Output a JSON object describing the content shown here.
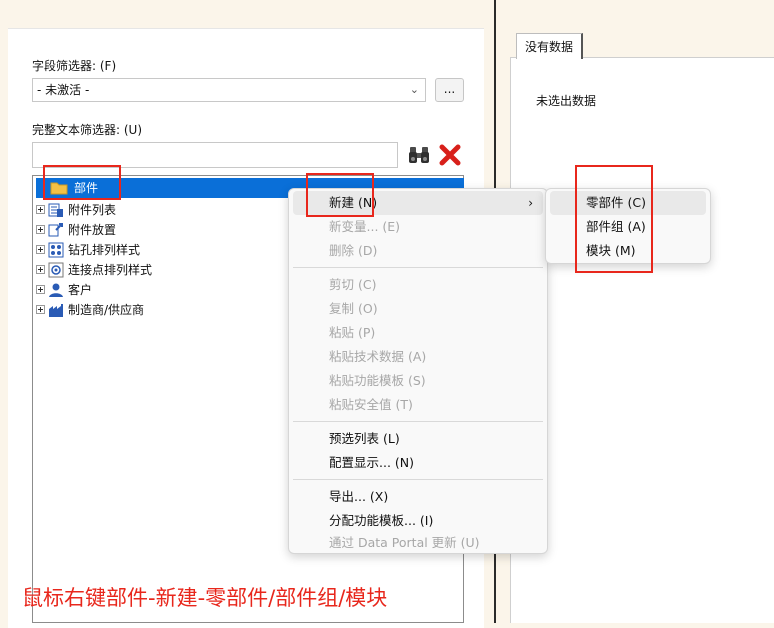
{
  "filters": {
    "field_filter_label": "字段筛选器: (F)",
    "field_filter_value": "- 未激活 -",
    "more_button": "...",
    "fulltext_label": "完整文本筛选器: (U)",
    "fulltext_value": ""
  },
  "tree": {
    "items": [
      {
        "label": "部件",
        "icon": "folder-icon"
      },
      {
        "label": "附件列表",
        "icon": "attachment-list-icon"
      },
      {
        "label": "附件放置",
        "icon": "attachment-placement-icon"
      },
      {
        "label": "钻孔排列样式",
        "icon": "drill-pattern-icon"
      },
      {
        "label": "连接点排列样式",
        "icon": "connection-point-icon"
      },
      {
        "label": "客户",
        "icon": "customer-icon"
      },
      {
        "label": "制造商/供应商",
        "icon": "manufacturer-icon"
      }
    ]
  },
  "context_menu": {
    "items": [
      {
        "label": "新建 (N)",
        "enabled": true,
        "submenu": true
      },
      {
        "label": "新变量... (E)",
        "enabled": false
      },
      {
        "label": "删除 (D)",
        "enabled": false
      },
      {
        "label": "剪切 (C)",
        "enabled": false
      },
      {
        "label": "复制 (O)",
        "enabled": false
      },
      {
        "label": "粘贴 (P)",
        "enabled": false
      },
      {
        "label": "粘贴技术数据 (A)",
        "enabled": false
      },
      {
        "label": "粘贴功能模板 (S)",
        "enabled": false
      },
      {
        "label": "粘贴安全值 (T)",
        "enabled": false
      },
      {
        "label": "预选列表 (L)",
        "enabled": true
      },
      {
        "label": "配置显示... (N)",
        "enabled": true
      },
      {
        "label": "导出... (X)",
        "enabled": true
      },
      {
        "label": "分配功能模板... (I)",
        "enabled": true
      },
      {
        "label": "通过 Data Portal 更新 (U)",
        "enabled": false
      }
    ]
  },
  "submenu": {
    "items": [
      {
        "label": "零部件 (C)"
      },
      {
        "label": "部件组 (A)"
      },
      {
        "label": "模块 (M)"
      }
    ]
  },
  "right_panel": {
    "tab_label": "没有数据",
    "message": "未选出数据"
  },
  "annotation": {
    "caption": "鼠标右键部件-新建-零部件/部件组/模块"
  },
  "colors": {
    "selection": "#0a6fd8",
    "annotation_red": "#e8271c",
    "background": "#fbf5ea"
  }
}
